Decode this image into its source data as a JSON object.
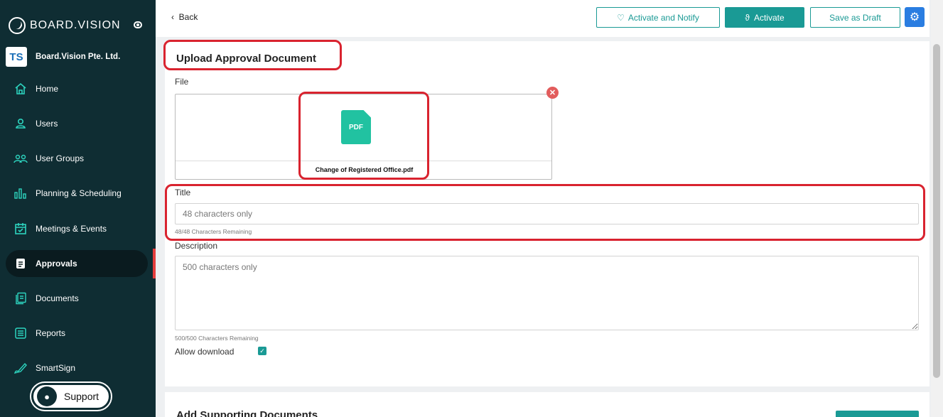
{
  "brand": {
    "name": "BOARD.VISION"
  },
  "org": {
    "initials": "TS",
    "name": "Board.Vision Pte. Ltd."
  },
  "nav": [
    {
      "label": "Home",
      "icon": "home-icon"
    },
    {
      "label": "Users",
      "icon": "user-icon"
    },
    {
      "label": "User Groups",
      "icon": "user-group-icon"
    },
    {
      "label": "Planning & Scheduling",
      "icon": "chart-icon"
    },
    {
      "label": "Meetings & Events",
      "icon": "calendar-icon"
    },
    {
      "label": "Approvals",
      "icon": "approval-icon",
      "active": true
    },
    {
      "label": "Documents",
      "icon": "documents-icon"
    },
    {
      "label": "Reports",
      "icon": "reports-icon"
    },
    {
      "label": "SmartSign",
      "icon": "pen-icon"
    }
  ],
  "support": {
    "label": "Support"
  },
  "topbar": {
    "back_label": "Back",
    "activate_notify_label": "Activate and Notify",
    "activate_label": "Activate",
    "save_draft_label": "Save as Draft"
  },
  "form": {
    "title": "Upload Approval Document",
    "file_label": "File",
    "file_type": "PDF",
    "file_name": "Change of Registered Office.pdf",
    "title_label": "Title",
    "title_placeholder": "48 characters only",
    "title_remaining": "48/48 Characters Remaining",
    "description_label": "Description",
    "description_placeholder": "500 characters only",
    "description_remaining": "500/500 Characters Remaining",
    "allow_download_label": "Allow download",
    "allow_download": true
  },
  "supporting": {
    "title": "Add Supporting Documents"
  },
  "colors": {
    "sidebar": "#0f2d33",
    "accent": "#1a9a95",
    "highlight": "#d9232f",
    "gear": "#2a7de1"
  }
}
